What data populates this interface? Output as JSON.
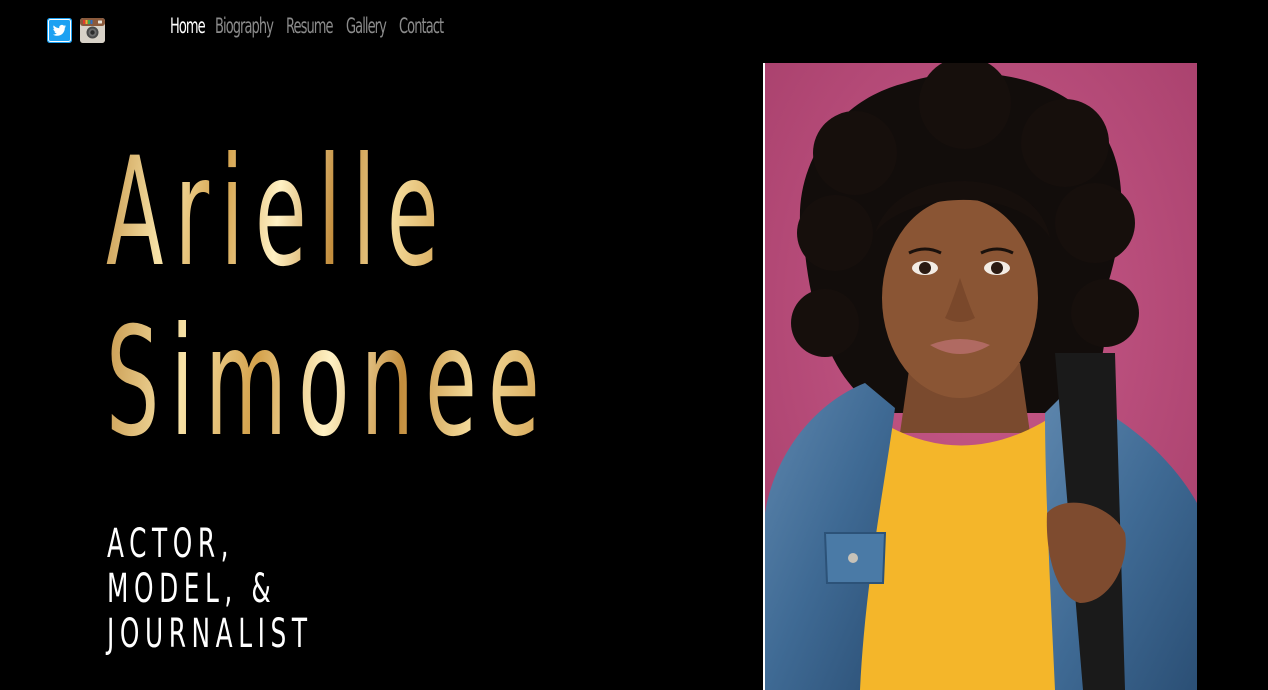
{
  "header": {
    "social": [
      {
        "icon": "twitter-icon"
      },
      {
        "icon": "instagram-icon"
      }
    ],
    "nav": [
      {
        "label": "Home",
        "active": true
      },
      {
        "label": "Biography",
        "active": false
      },
      {
        "label": "Resume",
        "active": false
      },
      {
        "label": "Gallery",
        "active": false
      },
      {
        "label": "Contact",
        "active": false
      }
    ]
  },
  "hero": {
    "first_name": "Arielle",
    "last_name": "Simonee",
    "tagline": [
      "ACTOR,",
      "MODEL, &",
      "JOURNALIST"
    ]
  },
  "colors": {
    "background": "#000000",
    "nav_inactive": "#8b8b8b",
    "nav_active": "#ffffff",
    "name_gold": "#d4a24c",
    "twitter_blue": "#1da1f2",
    "photo_backdrop": "#c05380"
  }
}
